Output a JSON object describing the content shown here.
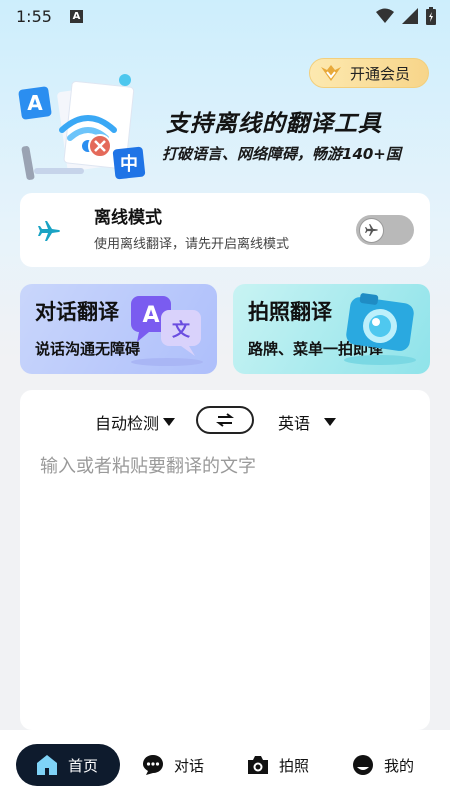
{
  "status_bar": {
    "time": "1:55",
    "notification_badge": "A"
  },
  "vip": {
    "label": "开通会员"
  },
  "hero": {
    "title": "支持离线的翻译工具",
    "subtitle": "打破语言、网络障碍，畅游140+国",
    "art_letters": {
      "a": "A",
      "zh": "中"
    }
  },
  "offline": {
    "title": "离线模式",
    "description": "使用离线翻译，请先开启离线模式",
    "enabled": false
  },
  "features": [
    {
      "title": "对话翻译",
      "subtitle": "说话沟通无障碍",
      "art_a": "A",
      "art_wen": "文"
    },
    {
      "title": "拍照翻译",
      "subtitle": "路牌、菜单一拍即译"
    }
  ],
  "translator": {
    "source_lang": "自动检测",
    "target_lang": "英语",
    "placeholder": "输入或者粘贴要翻译的文字"
  },
  "nav": {
    "items": [
      {
        "label": "首页",
        "icon": "home-icon",
        "active": true
      },
      {
        "label": "对话",
        "icon": "chat-icon",
        "active": false
      },
      {
        "label": "拍照",
        "icon": "camera-icon",
        "active": false
      },
      {
        "label": "我的",
        "icon": "profile-icon",
        "active": false
      }
    ]
  },
  "colors": {
    "accent_dark": "#0e1b2d",
    "plane": "#1aa3c4",
    "vip_gold": "#f7d58a"
  }
}
